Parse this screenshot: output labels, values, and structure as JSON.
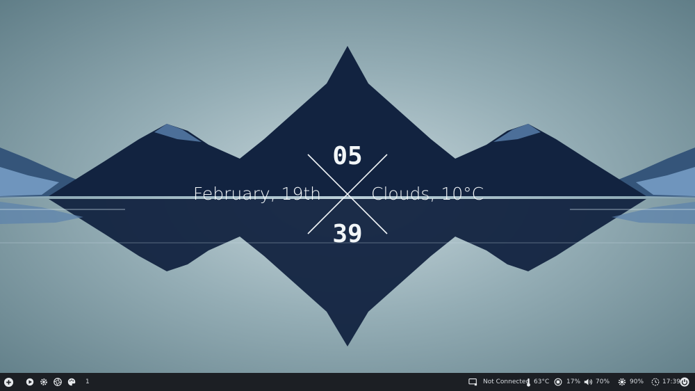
{
  "desktop": {
    "clock": {
      "hour": "05",
      "minute": "39"
    },
    "date": "February, 19th",
    "weather": "Clouds, 10°C"
  },
  "taskbar": {
    "left": {
      "launcher_icon": "plus-circle-icon",
      "media_icon": "play-circle-icon",
      "settings_icon": "gear-icon",
      "apps_icon": "aperture-icon",
      "theme_icon": "palette-icon",
      "workspace": "1"
    },
    "right": {
      "network": {
        "icon": "monitor-network-icon",
        "label": "Not Connected"
      },
      "temperature": {
        "icon": "thermometer-icon",
        "value": "63°C"
      },
      "cpu": {
        "icon": "cpu-icon",
        "value": "17%"
      },
      "volume": {
        "icon": "speaker-icon",
        "value": "70%"
      },
      "brightness": {
        "icon": "sun-icon",
        "value": "90%"
      },
      "time": {
        "icon": "clock-icon",
        "value": "17:39"
      },
      "power_icon": "power-icon"
    }
  },
  "colors": {
    "sky": "#6f8d96",
    "mountain": "#0f1d33",
    "taskbar": "#1c1f24",
    "text": "#f2f6f8"
  }
}
